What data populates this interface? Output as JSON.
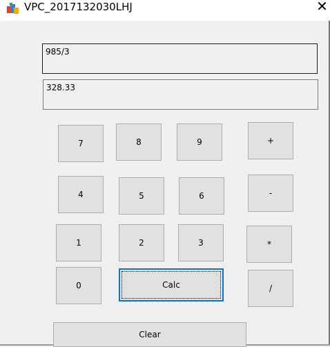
{
  "window": {
    "title": "VPC_2017132030LHJ",
    "close_glyph": "✕",
    "app_icon": "app-icon"
  },
  "display": {
    "expression": "985/3",
    "result": "328.33"
  },
  "buttons": {
    "seven": "7",
    "eight": "8",
    "nine": "9",
    "plus": "+",
    "four": "4",
    "five": "5",
    "six": "6",
    "minus": "-",
    "one": "1",
    "two": "2",
    "three": "3",
    "multiply": "*",
    "zero": "0",
    "calc": "Calc",
    "divide": "/",
    "clear": "Clear"
  },
  "colors": {
    "button_face": "#e1e1e1",
    "button_border": "#adadad",
    "focus": "#0078d7",
    "window_bg": "#f0f0f0"
  }
}
